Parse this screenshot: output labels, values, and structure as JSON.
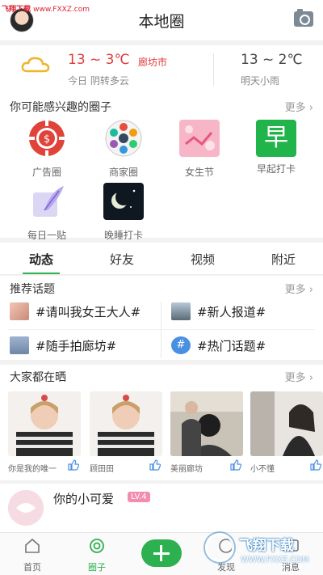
{
  "watermark_top": {
    "brand": "飞翔下载",
    "url": "www.FXXZ.com"
  },
  "header": {
    "title": "本地圈"
  },
  "weather": {
    "today": {
      "temp": "13 ~ 3℃",
      "city": "廊坊市",
      "desc": "今日 阴转多云"
    },
    "tomorrow": {
      "temp": "13 ~ 2℃",
      "desc": "明天小雨"
    }
  },
  "circles": {
    "title": "你可能感兴趣的圈子",
    "more": "更多",
    "items": [
      {
        "label": "广告圈",
        "icon": "chip-icon"
      },
      {
        "label": "商家圈",
        "icon": "flower-icon"
      },
      {
        "label": "女生节",
        "icon": "girls-day-icon"
      },
      {
        "label": "早起打卡",
        "icon": "zao-icon",
        "icon_text": "早"
      },
      {
        "label": "每日一贴",
        "icon": "feather-note-icon"
      },
      {
        "label": "晚睡打卡",
        "icon": "night-icon"
      }
    ]
  },
  "tabs": [
    "动态",
    "好友",
    "视频",
    "附近"
  ],
  "topics": {
    "title": "推荐话题",
    "more": "更多",
    "items": [
      {
        "text": "#请叫我女王大人#"
      },
      {
        "text": "#新人报道#"
      },
      {
        "text": "#随手拍廊坊#"
      },
      {
        "text": "#热门话题#",
        "icon_text": "#"
      }
    ]
  },
  "shares": {
    "title": "大家都在晒",
    "more": "更多",
    "items": [
      {
        "name": "你是我的唯一"
      },
      {
        "name": "顾田田"
      },
      {
        "name": "美丽廊坊"
      },
      {
        "name": "小不懂"
      }
    ]
  },
  "post": {
    "name": "你的小可爱",
    "level": "LV.4"
  },
  "bottom_nav": [
    {
      "label": "首页"
    },
    {
      "label": "圈子"
    },
    {
      "label": "发现"
    },
    {
      "label": "消息"
    }
  ],
  "watermark_bottom": {
    "brand": "飞翔下载",
    "url": "WWW.FXXZ.COM"
  },
  "colors": {
    "accent_green": "#2db04f",
    "temp_red": "#e03b3b",
    "level_pink": "#f28cb1"
  }
}
